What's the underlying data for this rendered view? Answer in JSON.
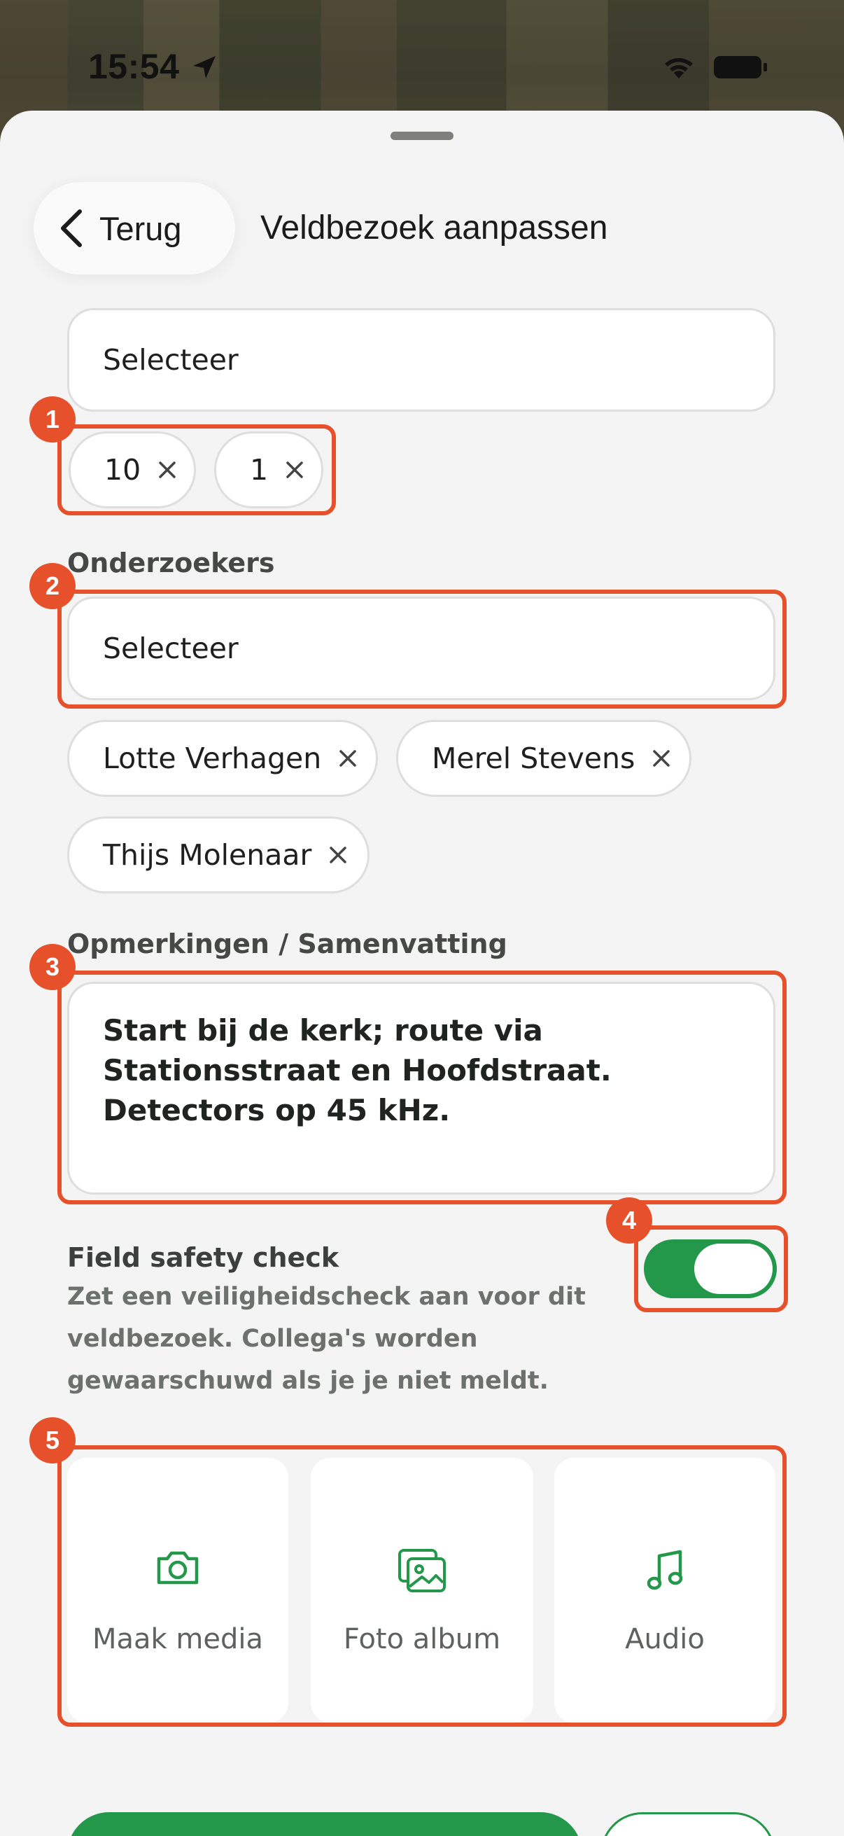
{
  "status_bar": {
    "time": "15:54",
    "location_icon": "location-arrow-icon",
    "wifi_icon": "wifi-icon",
    "battery_icon": "battery-icon"
  },
  "header": {
    "back_label": "Terug",
    "title": "Veldbezoek aanpassen"
  },
  "select_top": {
    "placeholder": "Selecteer",
    "chips": [
      "10",
      "1"
    ]
  },
  "researchers": {
    "label": "Onderzoekers",
    "placeholder": "Selecteer",
    "chips": [
      "Lotte Verhagen",
      "Merel Stevens",
      "Thijs Molenaar"
    ]
  },
  "remarks": {
    "label": "Opmerkingen / Samenvatting",
    "value": "Start bij de kerk; route via Stationsstraat en Hoofdstraat. Detectors op 45 kHz."
  },
  "safety": {
    "title": "Field safety check",
    "description": "Zet een veiligheidscheck aan voor dit veldbezoek. Collega's worden gewaarschuwd als je je niet meldt.",
    "enabled": true
  },
  "media": [
    {
      "label": "Maak media",
      "icon": "camera-icon"
    },
    {
      "label": "Foto album",
      "icon": "photo-album-icon"
    },
    {
      "label": "Audio",
      "icon": "music-note-icon"
    }
  ],
  "annotations": [
    "1",
    "2",
    "3",
    "4",
    "5"
  ],
  "colors": {
    "accent_green": "#23974a",
    "annotation_orange": "#e6502a"
  }
}
